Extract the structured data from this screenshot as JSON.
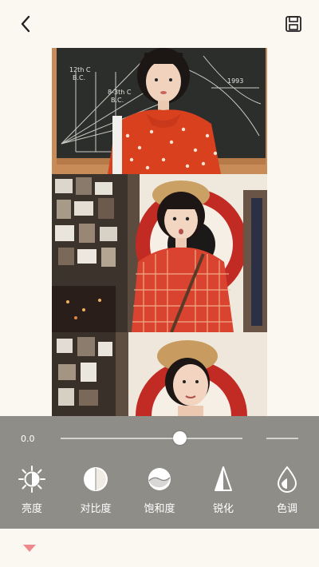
{
  "header": {
    "title": ""
  },
  "photo": {
    "panel1": {
      "board_labels": [
        "12th C",
        "B.C.",
        "8-3th C",
        "B.C.",
        "1993"
      ]
    }
  },
  "adjust": {
    "slider": {
      "value_text": "0.0",
      "position_fraction": 0.5
    },
    "tools": [
      {
        "label": "亮度",
        "icon": "brightness-icon"
      },
      {
        "label": "对比度",
        "icon": "contrast-icon"
      },
      {
        "label": "饱和度",
        "icon": "saturation-icon"
      },
      {
        "label": "锐化",
        "icon": "sharpen-icon"
      },
      {
        "label": "色调",
        "icon": "tone-icon"
      }
    ]
  },
  "colors": {
    "background": "#fbf8f1",
    "panel": "#8f8d88",
    "accent": "#ee8a8a",
    "icon": "#ffffff"
  }
}
